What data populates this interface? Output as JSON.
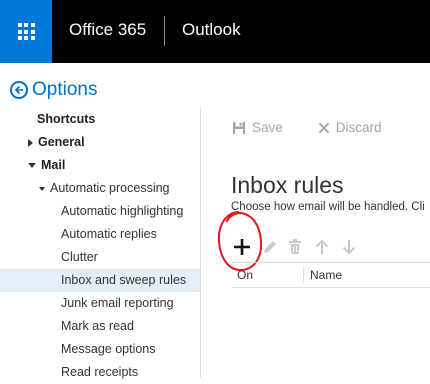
{
  "header": {
    "brand": "Office 365",
    "app": "Outlook"
  },
  "options": {
    "title": "Options"
  },
  "nav": {
    "items": [
      {
        "label": "Shortcuts"
      },
      {
        "label": "General"
      },
      {
        "label": "Mail"
      },
      {
        "label": "Automatic processing"
      },
      {
        "label": "Automatic highlighting"
      },
      {
        "label": "Automatic replies"
      },
      {
        "label": "Clutter"
      },
      {
        "label": "Inbox and sweep rules"
      },
      {
        "label": "Junk email reporting"
      },
      {
        "label": "Mark as read"
      },
      {
        "label": "Message options"
      },
      {
        "label": "Read receipts"
      }
    ]
  },
  "toolbar": {
    "save_label": "Save",
    "discard_label": "Discard"
  },
  "main": {
    "title": "Inbox rules",
    "description": "Choose how email will be handled. Cli"
  },
  "table": {
    "col_on": "On",
    "col_name": "Name"
  },
  "colors": {
    "accent": "#0078d7",
    "link": "#0072c6",
    "topbar": "#000000",
    "selected_bg": "#e3eef9",
    "annotation": "#e8141c"
  }
}
